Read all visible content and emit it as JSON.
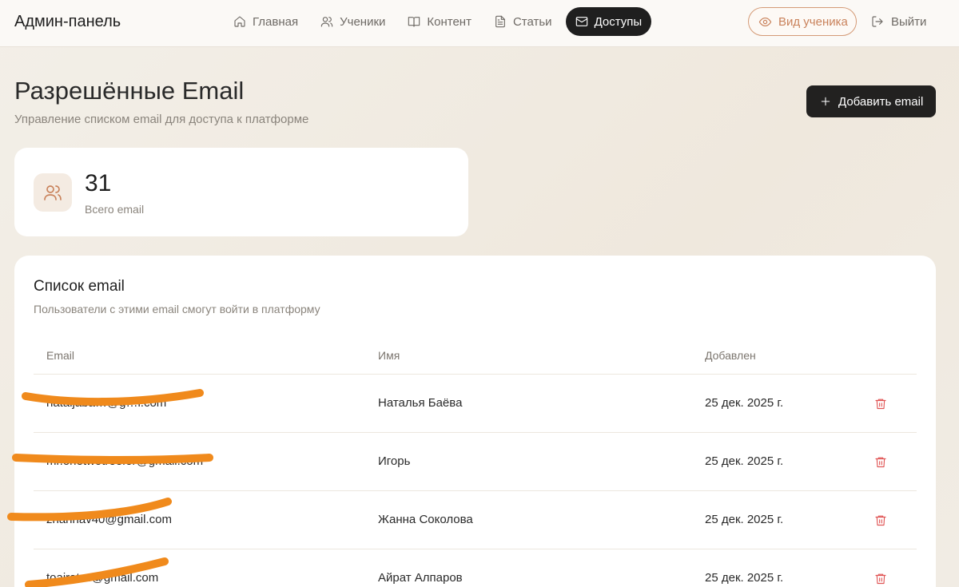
{
  "app": {
    "title": "Админ-панель"
  },
  "nav": {
    "items": [
      {
        "label": "Главная",
        "icon": "home-icon"
      },
      {
        "label": "Ученики",
        "icon": "users-icon"
      },
      {
        "label": "Контент",
        "icon": "book-icon"
      },
      {
        "label": "Статьи",
        "icon": "file-text-icon"
      },
      {
        "label": "Доступы",
        "icon": "mail-icon",
        "active": true
      }
    ],
    "student_view": "Вид ученика",
    "logout": "Выйти"
  },
  "header": {
    "title": "Разрешённые Email",
    "subtitle": "Управление списком email для доступа к платформе",
    "add_button": "Добавить email"
  },
  "stats": {
    "total_value": "31",
    "total_label": "Всего email"
  },
  "list": {
    "title": "Список email",
    "subtitle": "Пользователи с этими email смогут войти в платформу",
    "columns": [
      "Email",
      "Имя",
      "Добавлен"
    ],
    "rows": [
      {
        "email": "nataljaba…@g…l.com",
        "name": "Наталья Баёва",
        "date": "25 дек. 2025 г."
      },
      {
        "email": "mr.onetwotreefor@gmail.com",
        "name": "Игорь",
        "date": "25 дек. 2025 г."
      },
      {
        "email": "zhannav40@gmail.com",
        "name": "Жанна Соколова",
        "date": "25 дек. 2025 г."
      },
      {
        "email": "toairat…@gmail.com",
        "name": "Айрат Алпаров",
        "date": "25 дек. 2025 г."
      }
    ]
  },
  "colors": {
    "accent": "#c9825b",
    "dark": "#1f1f1f",
    "delete": "#e05555",
    "redaction": "#f08a1c"
  }
}
